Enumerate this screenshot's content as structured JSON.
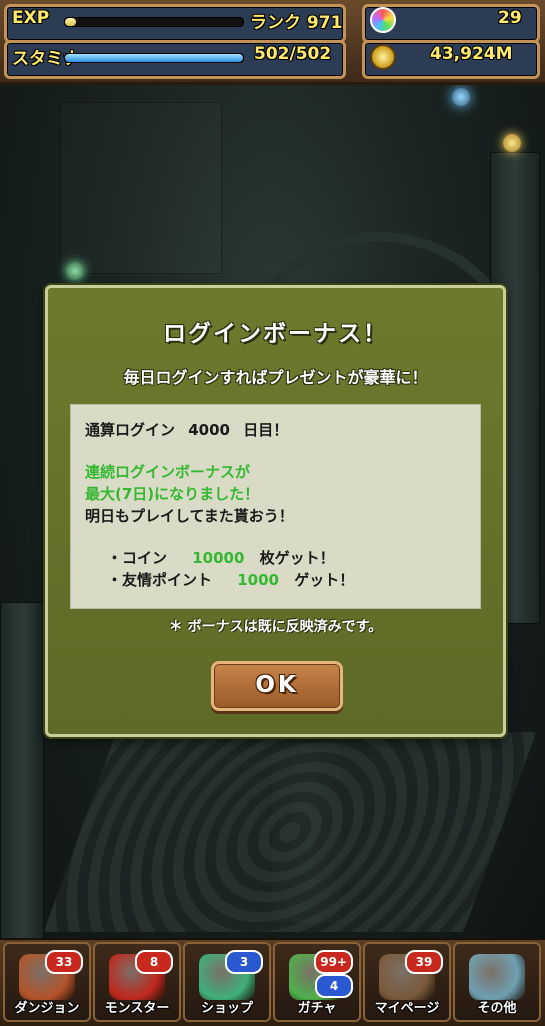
{
  "hud": {
    "exp_label": "EXP",
    "rank_label": "ランク 971",
    "exp_progress": 0.06,
    "stamina_label": "スタミナ",
    "stamina_value": "502/502",
    "stamina_progress": 1.0,
    "magic_stones": "29",
    "coins": "43,924M"
  },
  "dialog": {
    "title": "ログインボーナス！",
    "subtitle": "毎日ログインすればプレゼントが豪華に！",
    "total_login_prefix": "通算ログイン",
    "total_login_days": "4000",
    "total_login_suffix": "日目！",
    "streak_line1": "連続ログインボーナスが",
    "streak_line2": "最大(7日)になりました！",
    "streak_line3": "明日もプレイしてまた貰おう！",
    "reward1_label": "・コイン",
    "reward1_value": "10000",
    "reward1_suffix": "枚ゲット！",
    "reward2_label": "・友情ポイント",
    "reward2_value": "1000",
    "reward2_suffix": "ゲット！",
    "note": "＊ ボーナスは既に反映済みです。",
    "ok_label": "OK"
  },
  "nav": [
    {
      "label": "ダンジョン",
      "badge": "33",
      "art_color": "#b5542a"
    },
    {
      "label": "モンスター",
      "badge": "8",
      "art_color": "#c0281e"
    },
    {
      "label": "ショップ",
      "badge": "3",
      "art_color": "#3fb07a"
    },
    {
      "label": "ガチャ",
      "badge": "99+",
      "badge2": "4",
      "art_color": "#4fb04a"
    },
    {
      "label": "マイページ",
      "badge": "39",
      "art_color": "#7a5a3a"
    },
    {
      "label": "その他",
      "badge": "",
      "art_color": "#6fa0b0"
    }
  ],
  "colors": {
    "dialog_bg": "#6d7a2d",
    "highlight_green": "#33b82f",
    "hud_text": "#ffe86a"
  }
}
